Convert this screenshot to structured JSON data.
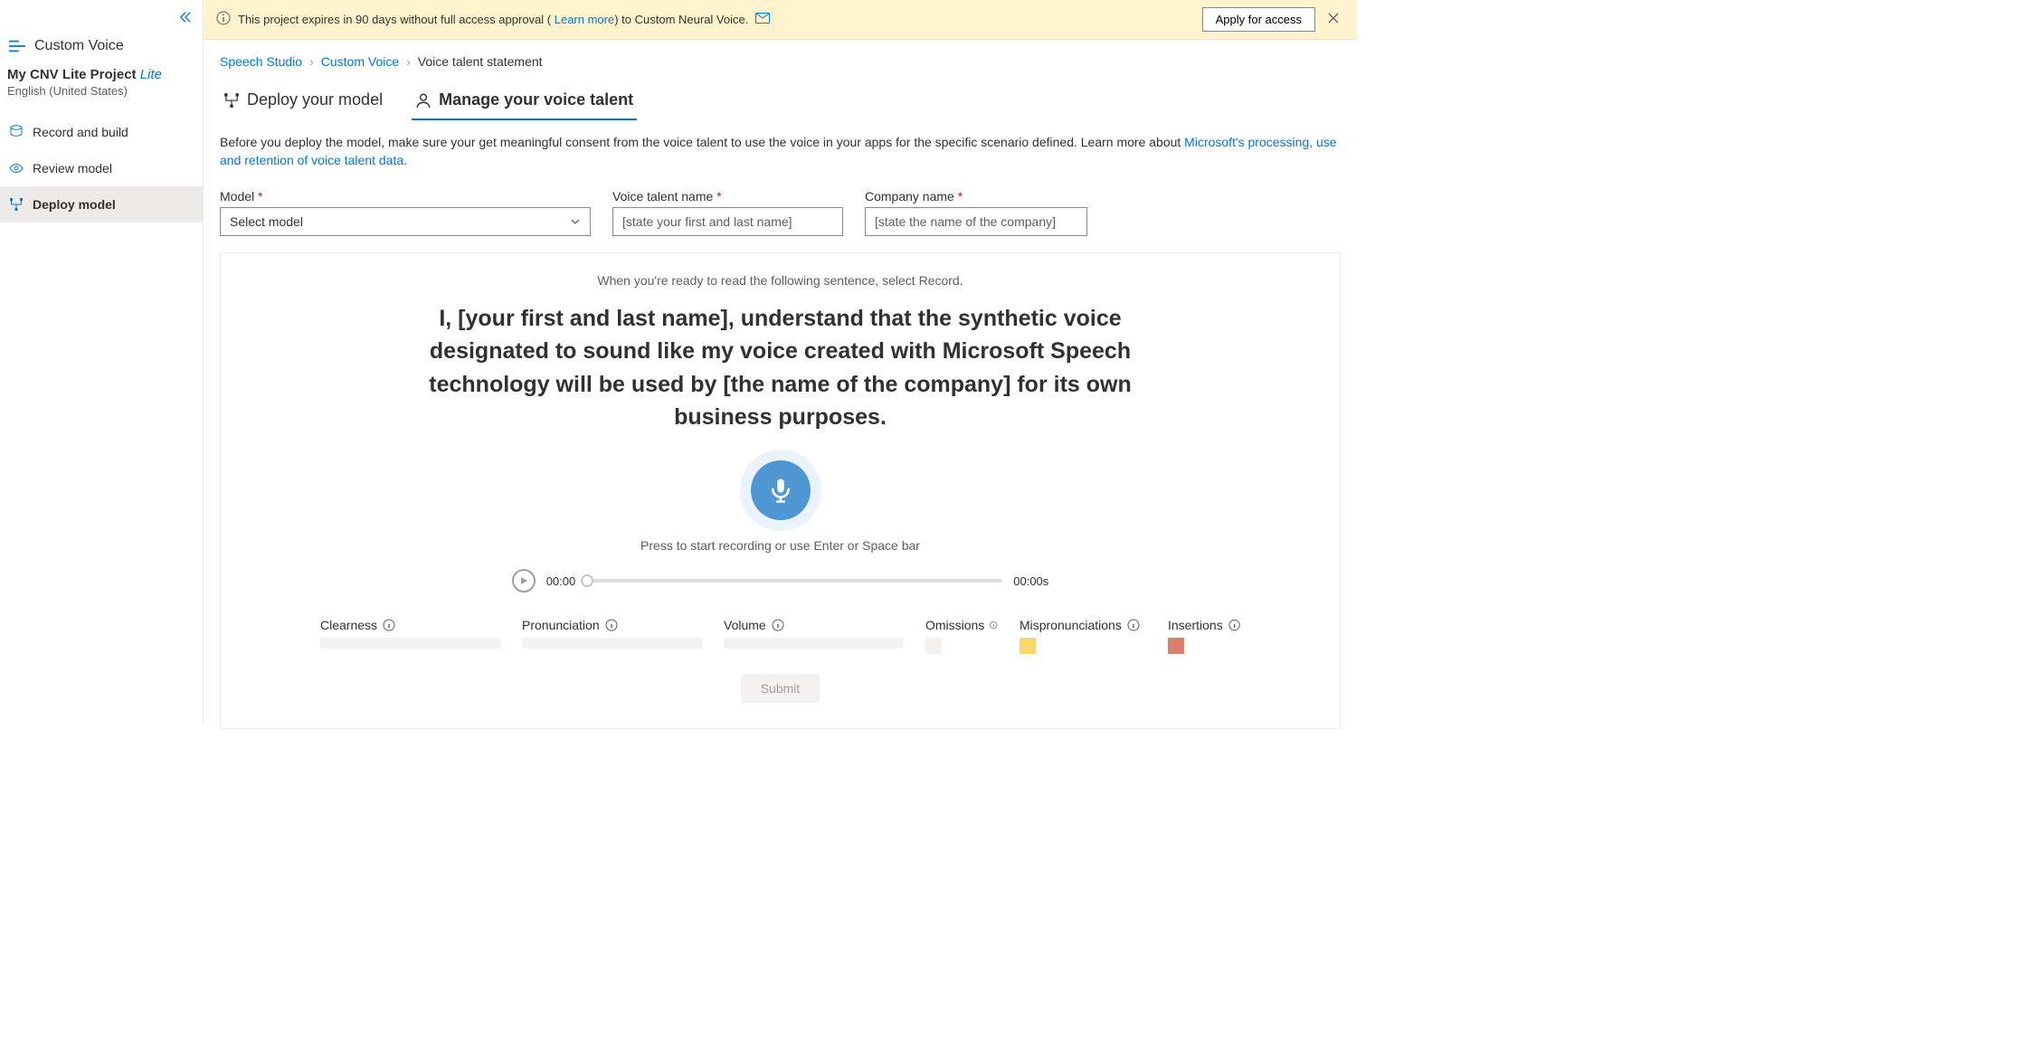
{
  "sidebar": {
    "app": "Custom Voice",
    "project_title": "My CNV Lite Project",
    "project_badge": "Lite",
    "project_lang": "English (United States)",
    "items": [
      {
        "label": "Record and build"
      },
      {
        "label": "Review model"
      },
      {
        "label": "Deploy model"
      }
    ]
  },
  "banner": {
    "text_pre": "This project expires in 90 days without full access approval (",
    "learn_more": "Learn more",
    "text_post": ") to Custom Neural Voice.",
    "apply": "Apply for access"
  },
  "breadcrumb": {
    "a": "Speech Studio",
    "b": "Custom Voice",
    "c": "Voice talent statement"
  },
  "tabs": {
    "deploy": "Deploy your model",
    "manage": "Manage your voice talent"
  },
  "desc": {
    "line": "Before you deploy the model, make sure your get meaningful consent from the voice talent to use the voice in your apps for the specific scenario defined. Learn more about ",
    "link": "Microsoft's processing, use and retention of voice talent data."
  },
  "form": {
    "model_label": "Model",
    "model_value": "Select model",
    "talent_label": "Voice talent name",
    "talent_placeholder": "[state your first and last name]",
    "company_label": "Company name",
    "company_placeholder": "[state the name of the company]"
  },
  "statement": {
    "hint": "When you're ready to read the following sentence, select Record.",
    "body": "I, [your first and last name], understand that the synthetic voice designated to sound like my voice created with Microsoft Speech technology will be used by [the name of the company] for its own business purposes.",
    "mic_hint": "Press to start recording or use Enter or Space bar",
    "time": "00:00",
    "duration": "00:00s"
  },
  "metrics": {
    "clearness": "Clearness",
    "pronunciation": "Pronunciation",
    "volume": "Volume",
    "omissions": "Omissions",
    "mispron": "Mispronunciations",
    "insertions": "Insertions"
  },
  "submit": "Submit"
}
